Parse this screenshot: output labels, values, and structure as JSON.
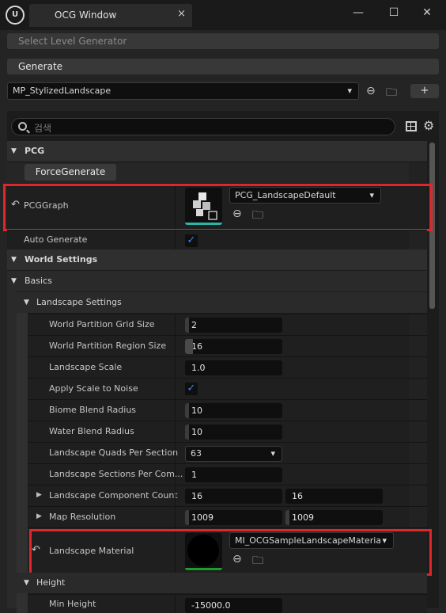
{
  "window": {
    "tab_title": "OCG Window",
    "tab_close": "×",
    "minimize": "—",
    "maximize": "☐",
    "close": "✕",
    "logo": "U"
  },
  "toolbar": {
    "select_level_generator": "Select Level Generator",
    "generate": "Generate",
    "level_asset": "MP_StylizedLandscape",
    "add_label": "+"
  },
  "search": {
    "placeholder": "검색"
  },
  "pcg": {
    "category": "PCG",
    "force_generate": "ForceGenerate",
    "pcg_graph_label": "PCGGraph",
    "pcg_graph_value": "PCG_LandscapeDefault",
    "auto_generate_label": "Auto Generate",
    "auto_generate": true
  },
  "world_settings": {
    "category": "World Settings",
    "basics": "Basics",
    "landscape_settings": "Landscape Settings",
    "rows": {
      "grid_size_label": "World Partition Grid Size",
      "grid_size": "2",
      "region_size_label": "World Partition Region Size",
      "region_size": "16",
      "landscape_scale_label": "Landscape Scale",
      "landscape_scale": "1.0",
      "apply_scale_label": "Apply Scale to Noise",
      "biome_blend_label": "Biome Blend Radius",
      "biome_blend": "10",
      "water_blend_label": "Water Blend Radius",
      "water_blend": "10",
      "quads_label": "Landscape Quads Per Section",
      "quads": "63",
      "sections_label": "Landscape Sections Per Com...",
      "sections": "1",
      "component_count_label": "Landscape Component Count",
      "component_count_x": "16",
      "component_count_y": "16",
      "map_resolution_label": "Map Resolution",
      "map_resolution_x": "1009",
      "map_resolution_y": "1009",
      "material_label": "Landscape Material",
      "material_value": "MI_OCGSampleLandscapeMaterial"
    },
    "height": "Height",
    "min_height_label": "Min Height",
    "min_height": "-15000.0"
  },
  "icons": {
    "browse": "⮐",
    "reset": "↶",
    "check": "✓",
    "gear": "⚙",
    "chevron": "⌄"
  }
}
